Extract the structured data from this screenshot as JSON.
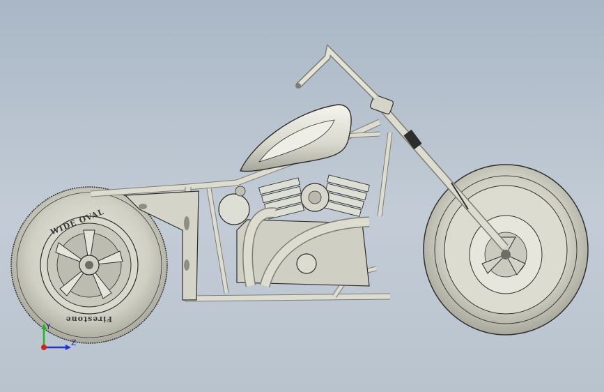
{
  "viewport": {
    "background_top": "#a9b7c6",
    "background_bottom": "#b9c3ce"
  },
  "model": {
    "type": "chopper-motorcycle-3d-model",
    "material_color": "#d4d4c8",
    "edge_color": "#2e2e2e",
    "rear_tire_text_top": "WIDE OVAL",
    "rear_tire_text_bottom": "Firestone"
  },
  "triad": {
    "x_label": "Y",
    "y_label": "Z",
    "y_color": "#21b521",
    "z_color": "#1f33d6",
    "x_color": "#d61f1f"
  }
}
